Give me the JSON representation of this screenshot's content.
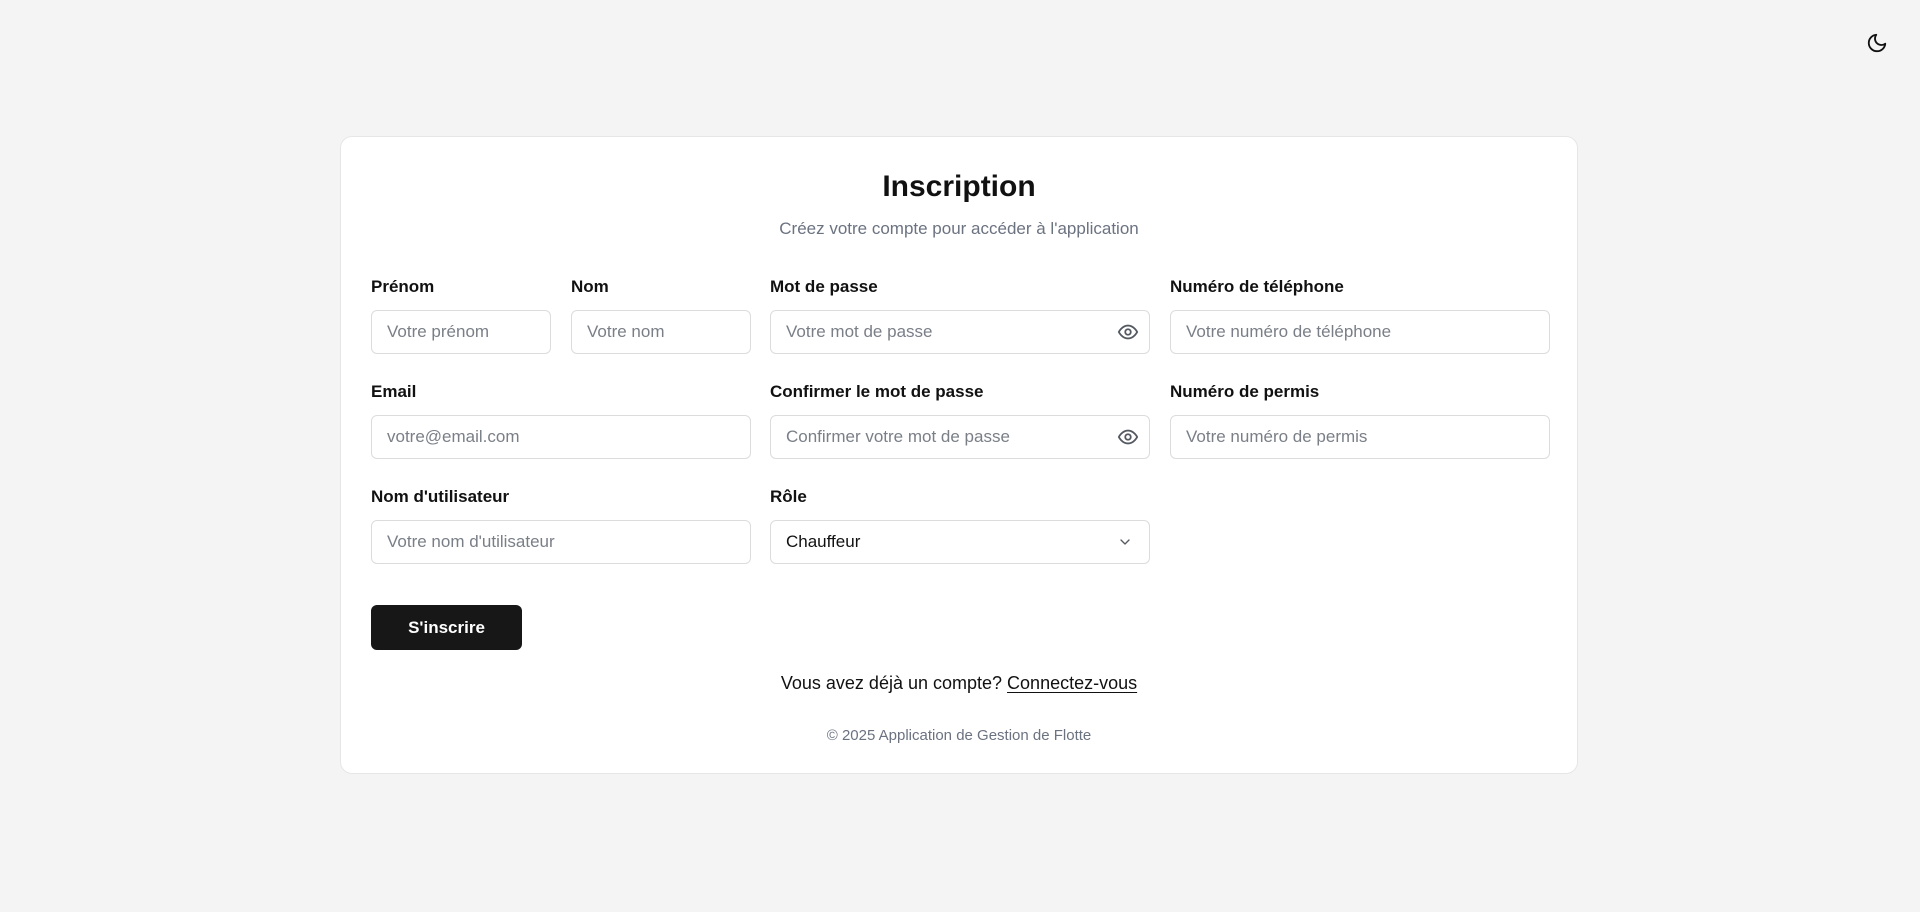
{
  "header": {
    "theme_toggle_icon": "moon-icon"
  },
  "form": {
    "title": "Inscription",
    "subtitle": "Créez votre compte pour accéder à l'application",
    "fields": {
      "first_name": {
        "label": "Prénom",
        "placeholder": "Votre prénom",
        "value": ""
      },
      "last_name": {
        "label": "Nom",
        "placeholder": "Votre nom",
        "value": ""
      },
      "password": {
        "label": "Mot de passe",
        "placeholder": "Votre mot de passe",
        "value": ""
      },
      "phone": {
        "label": "Numéro de téléphone",
        "placeholder": "Votre numéro de téléphone",
        "value": ""
      },
      "email": {
        "label": "Email",
        "placeholder": "votre@email.com",
        "value": ""
      },
      "confirm_password": {
        "label": "Confirmer le mot de passe",
        "placeholder": "Confirmer votre mot de passe",
        "value": ""
      },
      "license": {
        "label": "Numéro de permis",
        "placeholder": "Votre numéro de permis",
        "value": ""
      },
      "username": {
        "label": "Nom d'utilisateur",
        "placeholder": "Votre nom d'utilisateur",
        "value": ""
      },
      "role": {
        "label": "Rôle",
        "selected": "Chauffeur"
      }
    },
    "submit_label": "S'inscrire",
    "login_prompt": "Vous avez déjà un compte?",
    "login_link": "Connectez-vous",
    "footer": "© 2025 Application de Gestion de Flotte"
  },
  "colors": {
    "background": "#f4f4f4",
    "card": "#ffffff",
    "primary_button": "#171717",
    "muted_text": "#6b7280"
  }
}
